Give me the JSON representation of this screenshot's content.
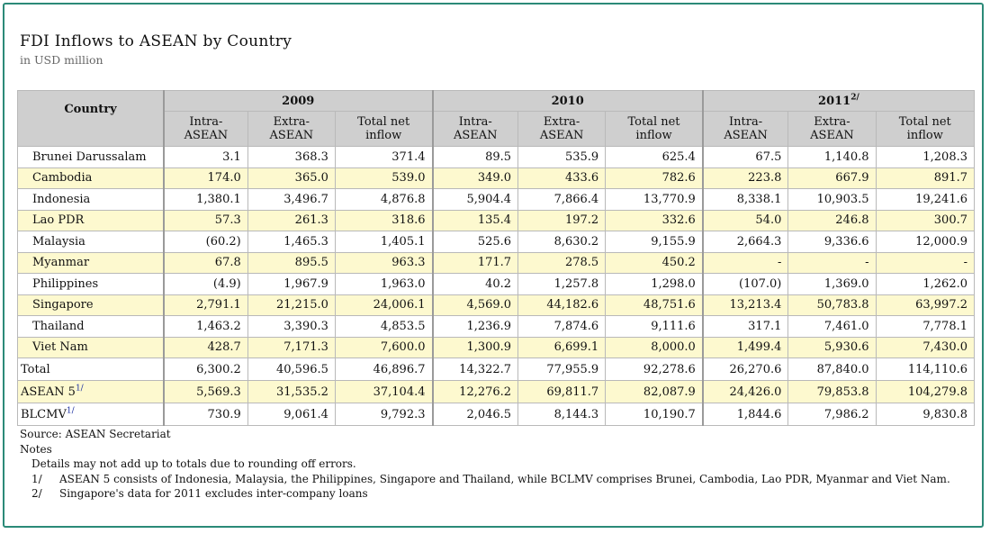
{
  "title": "FDI Inflows to ASEAN by Country",
  "subtitle": "in USD million",
  "table": {
    "country_header": "Country",
    "years": [
      {
        "label": "2009",
        "sup": ""
      },
      {
        "label": "2010",
        "sup": ""
      },
      {
        "label": "2011",
        "sup": "2/"
      }
    ],
    "subheaders": [
      "Intra-ASEAN",
      "Extra-ASEAN",
      "Total net inflow"
    ],
    "rows": [
      {
        "country": "Brunei Darussalam",
        "values": [
          "3.1",
          "368.3",
          "371.4",
          "89.5",
          "535.9",
          "625.4",
          "67.5",
          "1,140.8",
          "1,208.3"
        ]
      },
      {
        "country": "Cambodia",
        "values": [
          "174.0",
          "365.0",
          "539.0",
          "349.0",
          "433.6",
          "782.6",
          "223.8",
          "667.9",
          "891.7"
        ]
      },
      {
        "country": "Indonesia",
        "values": [
          "1,380.1",
          "3,496.7",
          "4,876.8",
          "5,904.4",
          "7,866.4",
          "13,770.9",
          "8,338.1",
          "10,903.5",
          "19,241.6"
        ]
      },
      {
        "country": "Lao PDR",
        "values": [
          "57.3",
          "261.3",
          "318.6",
          "135.4",
          "197.2",
          "332.6",
          "54.0",
          "246.8",
          "300.7"
        ]
      },
      {
        "country": "Malaysia",
        "values": [
          "(60.2)",
          "1,465.3",
          "1,405.1",
          "525.6",
          "8,630.2",
          "9,155.9",
          "2,664.3",
          "9,336.6",
          "12,000.9"
        ]
      },
      {
        "country": "Myanmar",
        "values": [
          "67.8",
          "895.5",
          "963.3",
          "171.7",
          "278.5",
          "450.2",
          "-",
          "-",
          "-"
        ]
      },
      {
        "country": "Philippines",
        "values": [
          "(4.9)",
          "1,967.9",
          "1,963.0",
          "40.2",
          "1,257.8",
          "1,298.0",
          "(107.0)",
          "1,369.0",
          "1,262.0"
        ]
      },
      {
        "country": "Singapore",
        "values": [
          "2,791.1",
          "21,215.0",
          "24,006.1",
          "4,569.0",
          "44,182.6",
          "48,751.6",
          "13,213.4",
          "50,783.8",
          "63,997.2"
        ]
      },
      {
        "country": "Thailand",
        "values": [
          "1,463.2",
          "3,390.3",
          "4,853.5",
          "1,236.9",
          "7,874.6",
          "9,111.6",
          "317.1",
          "7,461.0",
          "7,778.1"
        ]
      },
      {
        "country": "Viet Nam",
        "values": [
          "428.7",
          "7,171.3",
          "7,600.0",
          "1,300.9",
          "6,699.1",
          "8,000.0",
          "1,499.4",
          "5,930.6",
          "7,430.0"
        ]
      }
    ],
    "summary_rows": [
      {
        "label": "Total",
        "sup": "",
        "values": [
          "6,300.2",
          "40,596.5",
          "46,896.7",
          "14,322.7",
          "77,955.9",
          "92,278.6",
          "26,270.6",
          "87,840.0",
          "114,110.6"
        ]
      },
      {
        "label": "ASEAN 5",
        "sup": "1/",
        "values": [
          "5,569.3",
          "31,535.2",
          "37,104.4",
          "12,276.2",
          "69,811.7",
          "82,087.9",
          "24,426.0",
          "79,853.8",
          "104,279.8"
        ]
      },
      {
        "label": "BLCMV",
        "sup": "1/",
        "values": [
          "730.9",
          "9,061.4",
          "9,792.3",
          "2,046.5",
          "8,144.3",
          "10,190.7",
          "1,844.6",
          "7,986.2",
          "9,830.8"
        ]
      }
    ]
  },
  "footer": {
    "source": "Source: ASEAN Secretariat",
    "notes_heading": "Notes",
    "note_general": "Details may not add up to totals due to rounding off errors.",
    "notes": [
      {
        "marker": "1/",
        "text": "ASEAN 5 consists of Indonesia, Malaysia, the Philippines, Singapore and Thailand, while BCLMV comprises Brunei, Cambodia, Lao PDR, Myanmar and Viet Nam."
      },
      {
        "marker": "2/",
        "text": "Singapore's data for 2011 excludes inter-company loans"
      }
    ]
  },
  "colors": {
    "frame_border": "#2b8a78",
    "header_bg": "#cfcfcf",
    "alt_row_bg": "#fdf9cf",
    "footnote_ref": "#1a2fa0"
  }
}
